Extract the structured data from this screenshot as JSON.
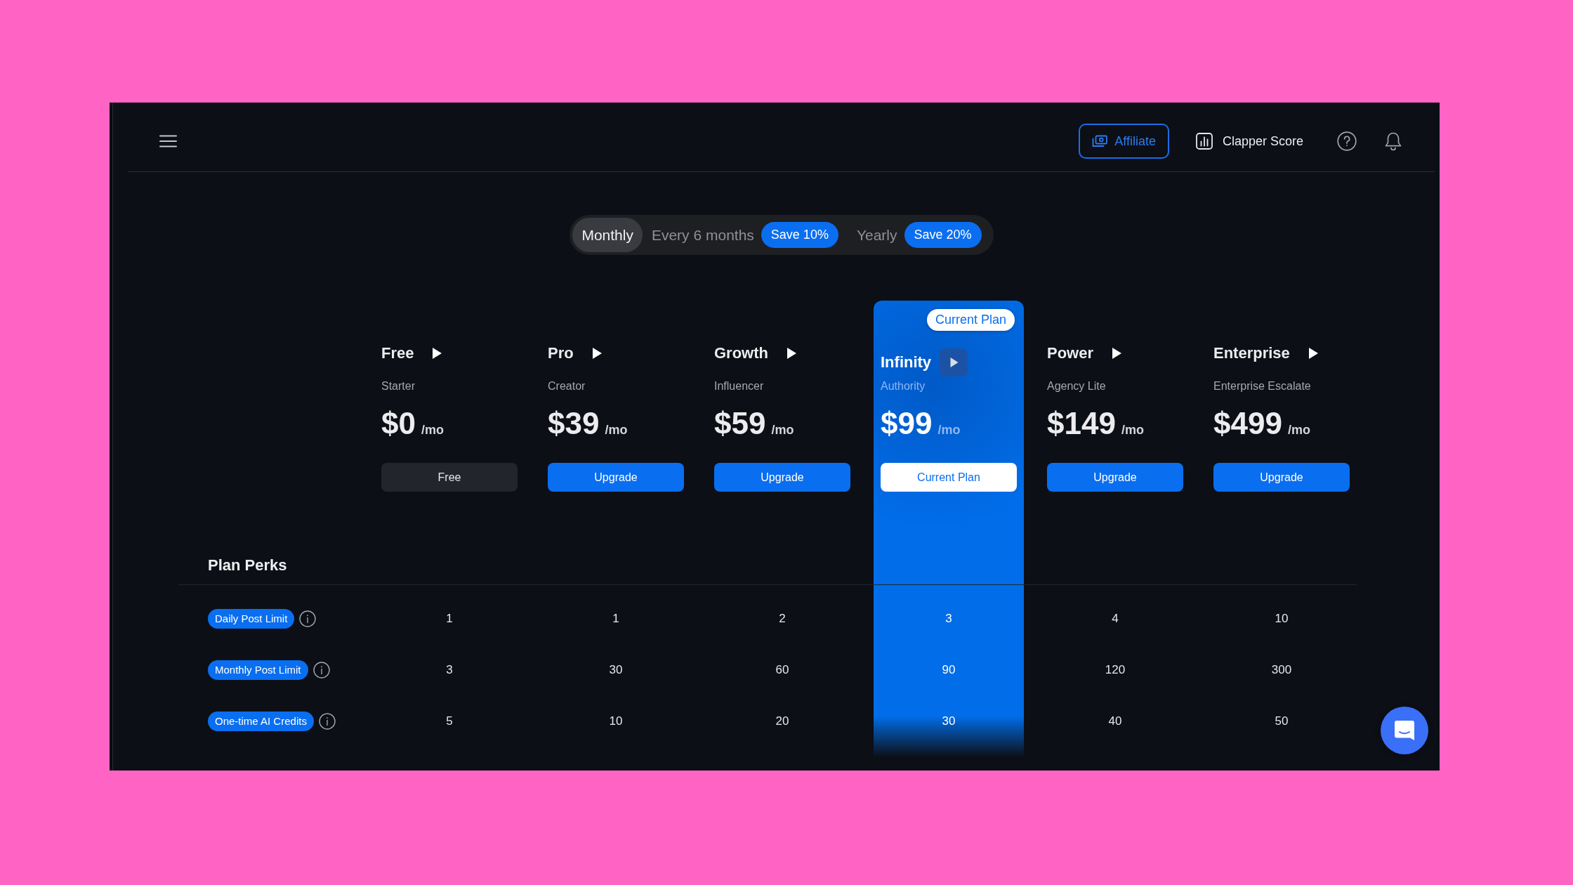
{
  "header": {
    "affiliate_button": "Affiliate",
    "score_button": "Clapper Score"
  },
  "billing_periods": [
    {
      "label": "Monthly",
      "selected": true
    },
    {
      "label": "Every 6 months",
      "badge": "Save 10%",
      "selected": false
    },
    {
      "label": "Yearly",
      "badge": "Save 20%",
      "selected": false
    }
  ],
  "plans": [
    {
      "name": "Free",
      "tier": "Starter",
      "price": "$0",
      "period": "/mo",
      "button": {
        "label": "Free",
        "kind": "secondary"
      },
      "current": false
    },
    {
      "name": "Pro",
      "tier": "Creator",
      "price": "$39",
      "period": "/mo",
      "button": {
        "label": "Upgrade",
        "kind": "primary"
      },
      "current": false
    },
    {
      "name": "Growth",
      "tier": "Influencer",
      "price": "$59",
      "period": "/mo",
      "button": {
        "label": "Upgrade",
        "kind": "primary"
      },
      "current": false
    },
    {
      "name": "Infinity",
      "tier": "Authority",
      "price": "$99",
      "period": "/mo",
      "badge": "Current Plan",
      "button": {
        "label": "Current Plan",
        "kind": "current"
      },
      "current": true
    },
    {
      "name": "Power",
      "tier": "Agency Lite",
      "price": "$149",
      "period": "/mo",
      "button": {
        "label": "Upgrade",
        "kind": "primary"
      },
      "current": false
    },
    {
      "name": "Enterprise",
      "tier": "Enterprise Escalate",
      "price": "$499",
      "period": "/mo",
      "button": {
        "label": "Upgrade",
        "kind": "primary"
      },
      "current": false
    }
  ],
  "perks": {
    "title": "Plan Perks",
    "rows": [
      {
        "label": "Daily Post Limit",
        "values": [
          "1",
          "1",
          "2",
          "3",
          "4",
          "10"
        ]
      },
      {
        "label": "Monthly Post Limit",
        "values": [
          "3",
          "30",
          "60",
          "90",
          "120",
          "300"
        ]
      },
      {
        "label": "One-time AI Credits",
        "values": [
          "5",
          "10",
          "20",
          "30",
          "40",
          "50"
        ]
      }
    ]
  }
}
